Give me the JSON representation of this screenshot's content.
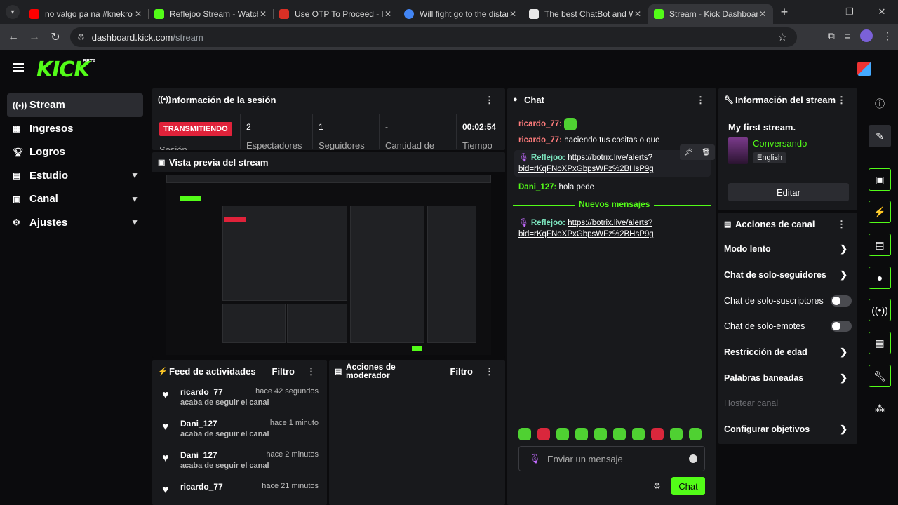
{
  "browser": {
    "tabs": [
      {
        "title": "no valgo pa na #knekro #s",
        "color": "#ff0000"
      },
      {
        "title": "Reflejoo Stream - Watch Li",
        "color": "#53fc18"
      },
      {
        "title": "Use OTP To Proceed - love",
        "color": "#d93025"
      },
      {
        "title": "Will fight go to the distanc",
        "color": "#4285f4"
      },
      {
        "title": "The best ChatBot and Wid",
        "color": "#e8e8e8"
      },
      {
        "title": "Stream - Kick Dashboard",
        "color": "#53fc18"
      }
    ],
    "url_host": "dashboard.kick.com",
    "url_path": "/stream"
  },
  "app": {
    "logo": "KICK",
    "beta": "BETA"
  },
  "sidebar": {
    "items": [
      {
        "label": "Stream",
        "icon": "broadcast-icon"
      },
      {
        "label": "Ingresos",
        "icon": "revenue-icon"
      },
      {
        "label": "Logros",
        "icon": "trophy-icon"
      },
      {
        "label": "Estudio",
        "icon": "studio-icon"
      },
      {
        "label": "Canal",
        "icon": "channel-icon"
      },
      {
        "label": "Ajustes",
        "icon": "gear-icon"
      }
    ]
  },
  "session": {
    "title": "Información de la sesión",
    "status": "TRANSMITIENDO",
    "status_label": "Sesión",
    "viewers": "2",
    "viewers_label": "Espectadores",
    "followers": "1",
    "followers_label": "Seguidores",
    "amount": "-",
    "amount_label": "Cantidad de",
    "time": "00:02:54",
    "time_label": "Tiempo"
  },
  "preview": {
    "title": "Vista previa del stream"
  },
  "feed": {
    "title": "Feed de actividades",
    "filter": "Filtro",
    "items": [
      {
        "name": "ricardo_77",
        "action": "acaba de seguir el canal",
        "time": "hace 42 segundos"
      },
      {
        "name": "Dani_127",
        "action": "acaba de seguir el canal",
        "time": "hace 1 minuto"
      },
      {
        "name": "Dani_127",
        "action": "acaba de seguir el canal",
        "time": "hace 2 minutos"
      },
      {
        "name": "ricardo_77",
        "action": "",
        "time": "hace 21 minutos"
      }
    ]
  },
  "mod": {
    "title": "Acciones de moderador",
    "filter": "Filtro"
  },
  "chat": {
    "title": "Chat",
    "messages": [
      {
        "user": "ricardo_77:",
        "text": ""
      },
      {
        "user": "ricardo_77:",
        "text": "haciendo tus cositas o que"
      },
      {
        "user": "Reflejoo:",
        "link1": "https://botrix.live/alerts?",
        "link2": "bid=rKqFNoXPxGbpsWFz%2BHsP9g"
      },
      {
        "user": "Dani_127:",
        "text": "hola pede"
      },
      {
        "user": "Reflejoo:",
        "link1": "https://botrix.live/alerts?",
        "link2": "bid=rKqFNoXPxGbpsWFz%2BHsP9g"
      }
    ],
    "new_messages": "Nuevos mensajes",
    "input_placeholder": "Enviar un mensaje",
    "send": "Chat"
  },
  "stream_info": {
    "title": "Información del stream",
    "stream_title": "My first stream.",
    "category": "Conversando",
    "language": "English",
    "edit": "Editar"
  },
  "channel_actions": {
    "title": "Acciones de canal",
    "items": [
      {
        "label": "Modo lento",
        "type": "arrow"
      },
      {
        "label": "Chat de solo-seguidores",
        "type": "arrow"
      },
      {
        "label": "Chat de solo-suscriptores",
        "type": "toggle"
      },
      {
        "label": "Chat de solo-emotes",
        "type": "toggle"
      },
      {
        "label": "Restricción de edad",
        "type": "arrow"
      },
      {
        "label": "Palabras baneadas",
        "type": "arrow"
      },
      {
        "label": "Hostear canal",
        "type": "dim"
      },
      {
        "label": "Configurar objetivos",
        "type": "arrow"
      }
    ]
  },
  "colors": {
    "accent": "#53fc18",
    "live": "#e0223a",
    "panel": "#18191c",
    "bg": "#0b0b0d"
  }
}
